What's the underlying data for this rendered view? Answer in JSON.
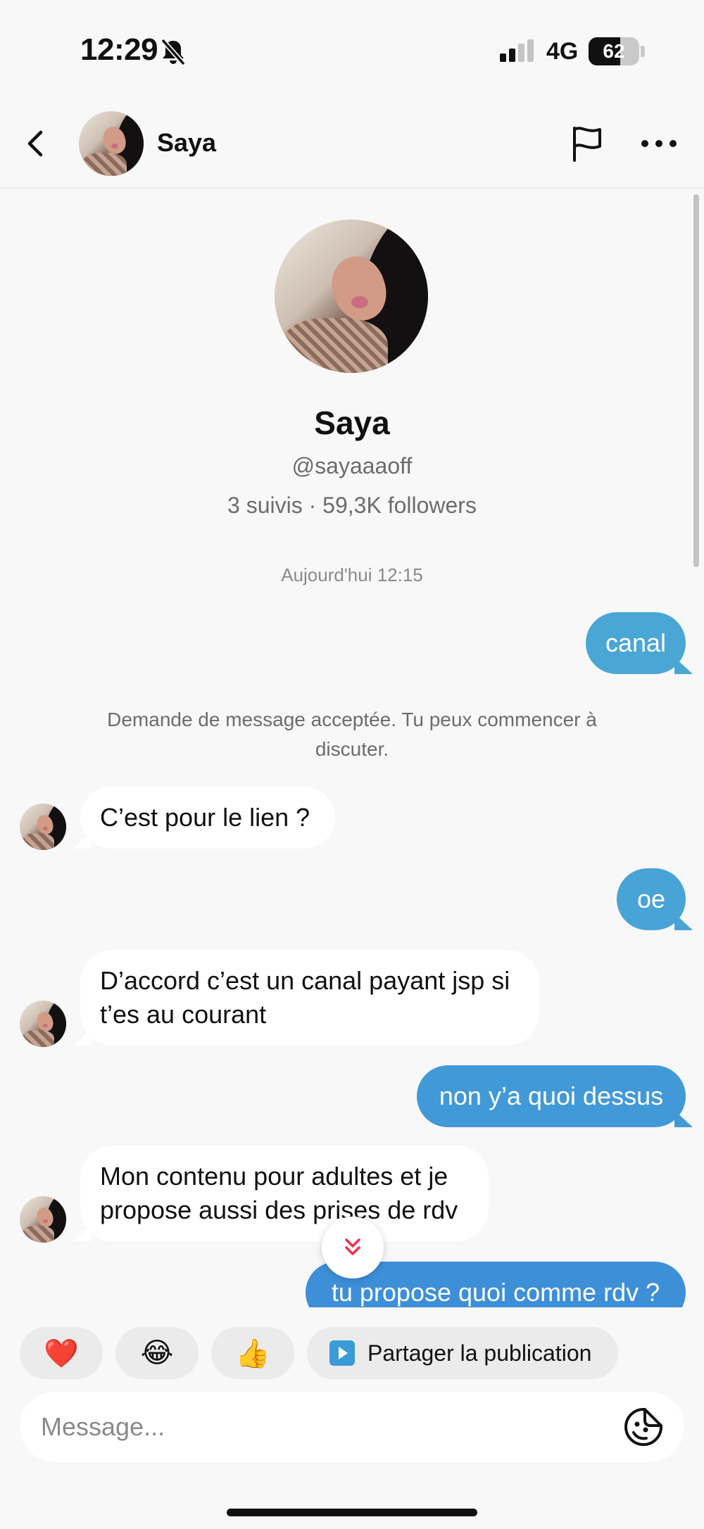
{
  "status_bar": {
    "time": "12:29",
    "network": "4G",
    "battery": "62",
    "battery_level": 0.62
  },
  "header": {
    "name": "Saya"
  },
  "profile": {
    "name": "Saya",
    "handle": "@sayaaaoff",
    "stats": "3 suivis · 59,3K followers"
  },
  "conversation": {
    "timestamp": "Aujourd'hui 12:15",
    "system_note": "Demande de message acceptée. Tu peux commencer à discuter.",
    "messages": [
      {
        "from": "me",
        "text": "canal"
      },
      {
        "from": "them",
        "text": "C’est pour le lien ?"
      },
      {
        "from": "me",
        "text": "oe"
      },
      {
        "from": "them",
        "text": "D’accord c’est un canal payant jsp si t’es au courant"
      },
      {
        "from": "me",
        "text": "non y’a quoi dessus"
      },
      {
        "from": "them",
        "text": "Mon contenu pour adultes et je propose aussi des prises de rdv"
      },
      {
        "from": "me",
        "text": "tu propose quoi comme rdv ?"
      }
    ]
  },
  "quick_reactions": [
    "❤️",
    "😂",
    "👍"
  ],
  "share_chip": {
    "label": "Partager la publication"
  },
  "composer": {
    "placeholder": "Message..."
  },
  "colors": {
    "outgoing_bubble": "#4aa6d5",
    "outgoing_bubble_bottom": "#3d8fd8",
    "accent_red": "#f0304f"
  }
}
